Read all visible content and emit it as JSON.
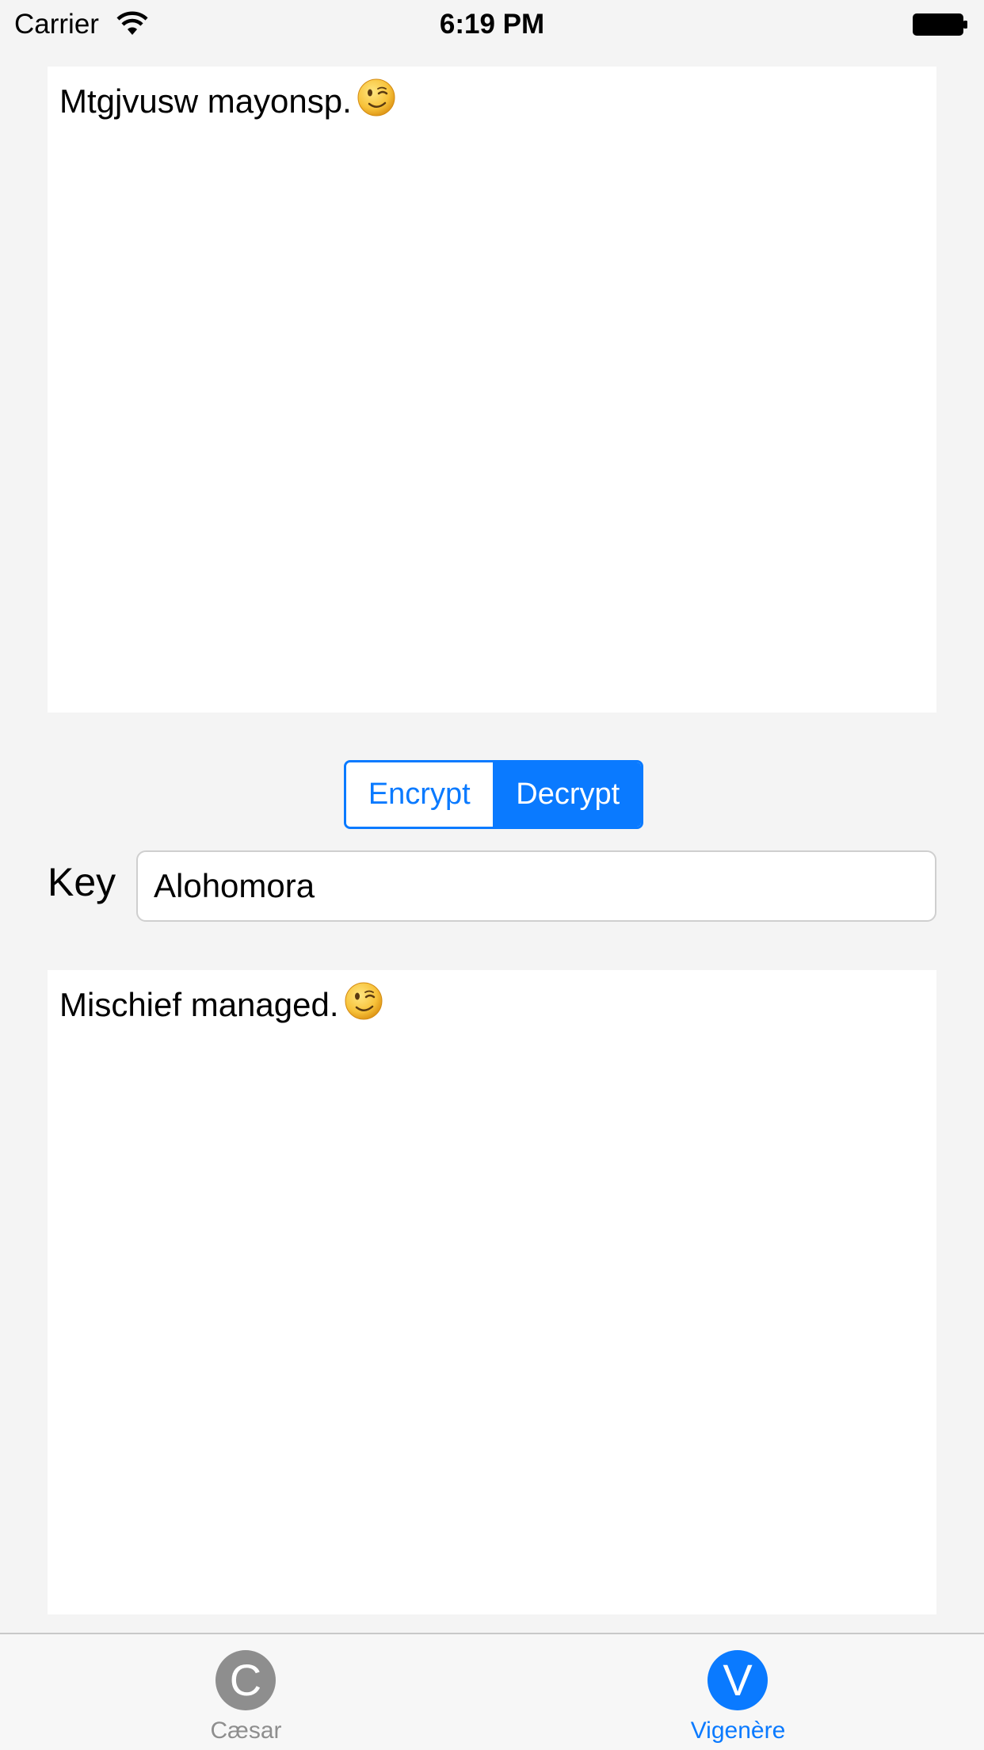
{
  "status_bar": {
    "carrier": "Carrier",
    "time": "6:19 PM"
  },
  "input_text": {
    "value": "Mtgjvusw mayonsp."
  },
  "mode_control": {
    "options": [
      "Encrypt",
      "Decrypt"
    ],
    "selected": "Decrypt"
  },
  "key": {
    "label": "Key",
    "value": "Alohomora"
  },
  "output_text": {
    "value": "Mischief managed."
  },
  "tab_bar": {
    "tabs": [
      {
        "icon_letter": "C",
        "label": "Cæsar",
        "selected": false
      },
      {
        "icon_letter": "V",
        "label": "Vigenère",
        "selected": true
      }
    ]
  },
  "colors": {
    "accent": "#0a7aff",
    "inactive": "#8e8e8e",
    "background": "#f4f4f4"
  }
}
